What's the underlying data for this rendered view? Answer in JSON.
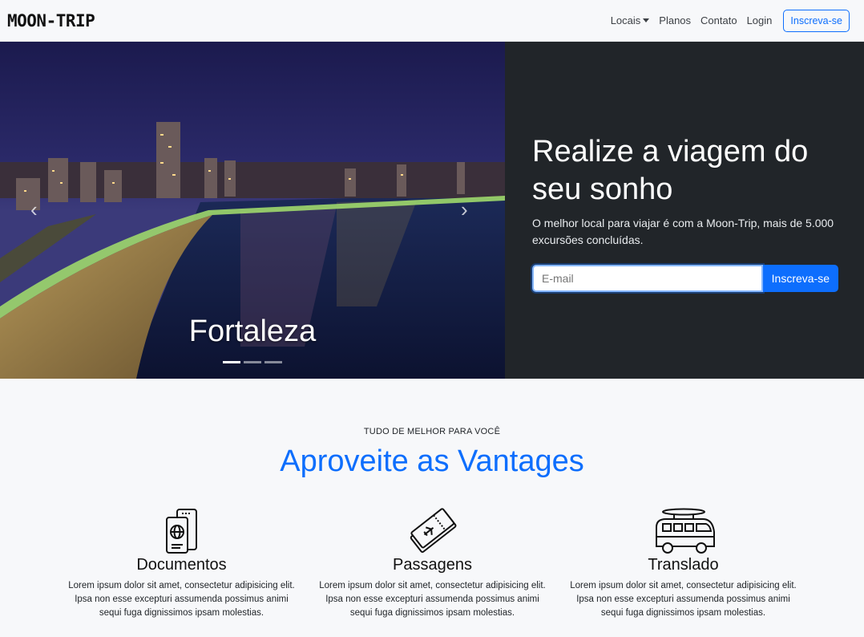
{
  "brand": "MOON-TRIP",
  "nav": {
    "locais": "Locais",
    "planos": "Planos",
    "contato": "Contato",
    "login": "Login",
    "signup": "Inscreva-se"
  },
  "carousel": {
    "caption": "Fortaleza",
    "slide_count": 3,
    "active_index": 0
  },
  "hero": {
    "title": "Realize a viagem do seu sonho",
    "text": "O melhor local para viajar é com a Moon-Trip, mais de 5.000 excursões concluídas.",
    "email_placeholder": "E-mail",
    "email_value": "",
    "button": "Inscreva-se"
  },
  "features": {
    "eyebrow": "TUDO DE MELHOR PARA VOCÊ",
    "title": "Aproveite as Vantages",
    "items": [
      {
        "icon": "passport-icon",
        "title": "Documentos",
        "text": "Lorem ipsum dolor sit amet, consectetur adipisicing elit. Ipsa non esse excepturi assumenda possimus animi sequi fuga dignissimos ipsam molestias."
      },
      {
        "icon": "ticket-icon",
        "title": "Passagens",
        "text": "Lorem ipsum dolor sit amet, consectetur adipisicing elit. Ipsa non esse excepturi assumenda possimus animi sequi fuga dignissimos ipsam molestias."
      },
      {
        "icon": "van-icon",
        "title": "Translado",
        "text": "Lorem ipsum dolor sit amet, consectetur adipisicing elit. Ipsa non esse excepturi assumenda possimus animi sequi fuga dignissimos ipsam molestias."
      }
    ]
  },
  "colors": {
    "primary": "#0d6efd",
    "dark_panel": "#212529",
    "page_bg": "#f7f8fa"
  }
}
